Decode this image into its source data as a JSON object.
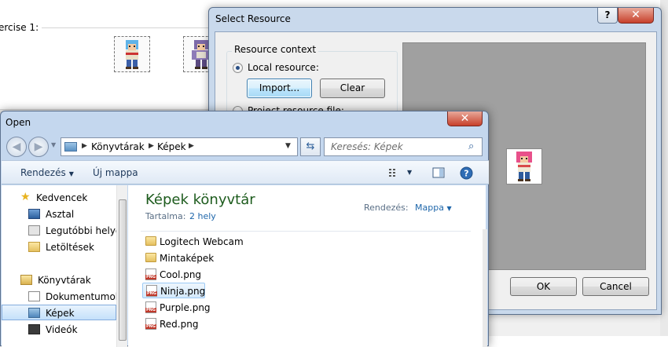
{
  "background": {
    "group_label": "ercise 1:"
  },
  "select_resource": {
    "title": "Select Resource",
    "help_label": "?",
    "close_label": "✕",
    "group_title": "Resource context",
    "local_label": "Local resource:",
    "import_label": "Import...",
    "clear_label": "Clear",
    "project_label": "Project resource file:",
    "ok_label": "OK",
    "cancel_label": "Cancel"
  },
  "open_dialog": {
    "title": "Open",
    "close_label": "✕",
    "breadcrumbs": [
      "Könyvtárak",
      "Képek"
    ],
    "search_placeholder": "Keresés: Képek",
    "toolbar": {
      "organize": "Rendezés",
      "new_folder": "Új mappa"
    },
    "nav": {
      "favorites": "Kedvencek",
      "desktop": "Asztal",
      "recent": "Legutóbbi helyek",
      "downloads": "Letöltések",
      "libraries": "Könyvtárak",
      "documents": "Dokumentumok",
      "pictures": "Képek",
      "videos": "Videók"
    },
    "library": {
      "title": "Képek könyvtár",
      "contents_label": "Tartalma:",
      "contents_value": "2 hely",
      "arrange_label": "Rendezés:",
      "arrange_value": "Mappa"
    },
    "files": [
      {
        "name": "Logitech Webcam",
        "kind": "folder"
      },
      {
        "name": "Mintaképek",
        "kind": "folder"
      },
      {
        "name": "Cool.png",
        "kind": "png"
      },
      {
        "name": "Ninja.png",
        "kind": "png"
      },
      {
        "name": "Purple.png",
        "kind": "png"
      },
      {
        "name": "Red.png",
        "kind": "png"
      }
    ]
  }
}
